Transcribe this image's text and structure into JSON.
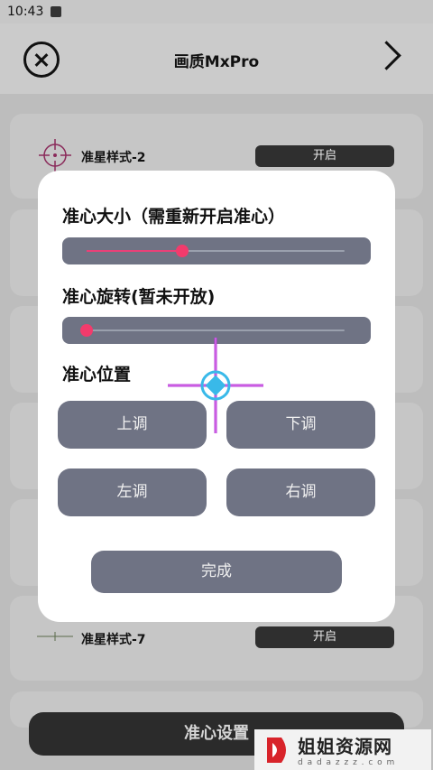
{
  "status": {
    "time": "10:43"
  },
  "header": {
    "title": "画质MxPro"
  },
  "list": {
    "item_top": {
      "label": "准星样式-2",
      "toggle": "开启"
    },
    "item_bottom": {
      "label": "准星样式-7",
      "toggle": "开启"
    }
  },
  "bottom": {
    "label": "准心设置"
  },
  "dialog": {
    "size_title": "准心大小（需重新开启准心）",
    "size_value": 0.37,
    "rotation_title": "准心旋转(暂未开放)",
    "rotation_value": 0.0,
    "position_title": "准心位置",
    "up_label": "上调",
    "down_label": "下调",
    "left_label": "左调",
    "right_label": "右调",
    "done_label": "完成"
  },
  "watermark": {
    "main": "姐姐资源网",
    "sub": "d a d a z z z . c o m"
  },
  "colors": {
    "accent": "#f23b6c",
    "button": "#6f7384",
    "crosshair": "#b33ad6",
    "crosshair_center": "#39b9e9"
  }
}
